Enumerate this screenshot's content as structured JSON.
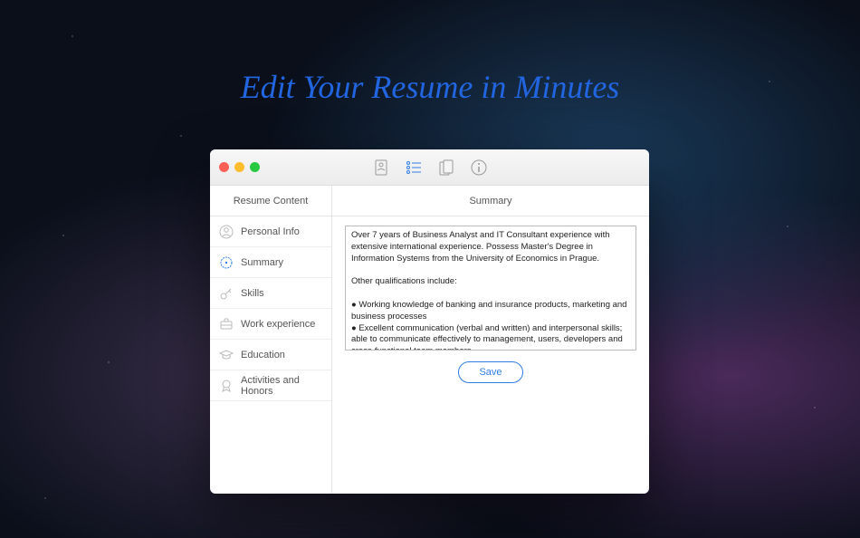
{
  "headline": "Edit Your Resume in Minutes",
  "sidebar": {
    "header": "Resume Content",
    "items": [
      {
        "label": "Personal Info"
      },
      {
        "label": "Summary"
      },
      {
        "label": "Skills"
      },
      {
        "label": "Work experience"
      },
      {
        "label": "Education"
      },
      {
        "label": "Activities and Honors"
      }
    ]
  },
  "main": {
    "header": "Summary",
    "textarea_value": "Over 7 years of Business Analyst and IT Consultant experience with extensive international experience. Possess Master's Degree in Information Systems from the University of Economics in Prague.\n\nOther qualifications include:\n\n● Working knowledge of banking and insurance products, marketing and business processes\n● Excellent communication (verbal and written) and interpersonal skills; able to communicate effectively to management, users, developers and cross-functional team members.\n● Well-developed analytical and problem solving skills\n● Expertise in gathering, analyzing and documenting user stories, business and",
    "save_button": "Save"
  }
}
